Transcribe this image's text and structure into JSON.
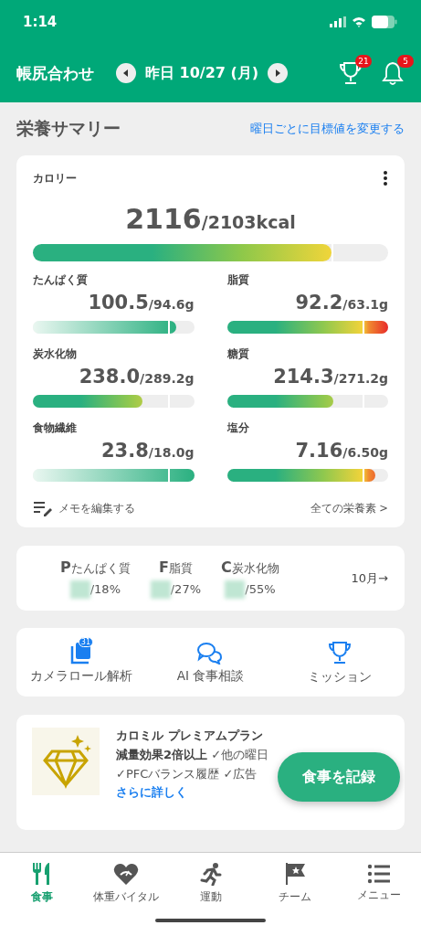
{
  "status_bar": {
    "time": "1:14"
  },
  "header": {
    "title": "帳尻合わせ",
    "date": "昨日 10/27 (月)",
    "trophy_badge": "21",
    "bell_badge": "5"
  },
  "section": {
    "title": "栄養サマリー",
    "link": "曜日ごとに目標値を変更する"
  },
  "calorie": {
    "label": "カロリー",
    "value": "2116",
    "target": "/2103kcal",
    "level": 0.84
  },
  "nutrients": [
    {
      "name": "たんぱく質",
      "value": "100.5",
      "target": "/94.6g",
      "level": 0.89,
      "kind": "fade"
    },
    {
      "name": "脂質",
      "value": "92.2",
      "target": "/63.1g",
      "level": 1.0,
      "kind": "warm"
    },
    {
      "name": "炭水化物",
      "value": "238.0",
      "target": "/289.2g",
      "level": 0.68,
      "kind": "warm"
    },
    {
      "name": "糖質",
      "value": "214.3",
      "target": "/271.2g",
      "level": 0.66,
      "kind": "warm"
    },
    {
      "name": "食物繊維",
      "value": "23.8",
      "target": "/18.0g",
      "level": 1.0,
      "kind": "fade"
    },
    {
      "name": "塩分",
      "value": "7.16",
      "target": "/6.50g",
      "level": 0.92,
      "kind": "warm"
    }
  ],
  "card_footer": {
    "memo": "メモを編集する",
    "all": "全ての栄養素 >"
  },
  "pfc": {
    "items": [
      {
        "letter": "P",
        "name": "たんぱく質",
        "target": "/18%"
      },
      {
        "letter": "F",
        "name": "脂質",
        "target": "/27%"
      },
      {
        "letter": "C",
        "name": "炭水化物",
        "target": "/55%"
      }
    ],
    "month": "10月→"
  },
  "actions": [
    {
      "kind": "camera",
      "label": "カメラロール解析",
      "badge": "31"
    },
    {
      "kind": "chat",
      "label": "AI 食事相談"
    },
    {
      "kind": "trophy",
      "label": "ミッション"
    }
  ],
  "premium": {
    "title": "カロミル プレミアムプラン",
    "line_1_bold": "減量効果2倍以上",
    "line_1_rest": "✓他の曜日",
    "line_2": "✓PFCバランス履歴 ✓広告",
    "link": "さらに詳しく"
  },
  "fab": {
    "label": "食事を記録"
  },
  "tabs": [
    {
      "kind": "meal",
      "label": "食事",
      "selected": true
    },
    {
      "kind": "heart",
      "label": "体重バイタル",
      "selected": false
    },
    {
      "kind": "run",
      "label": "運動",
      "selected": false
    },
    {
      "kind": "flag",
      "label": "チーム",
      "selected": false
    },
    {
      "kind": "menu",
      "label": "メニュー",
      "selected": false
    }
  ]
}
